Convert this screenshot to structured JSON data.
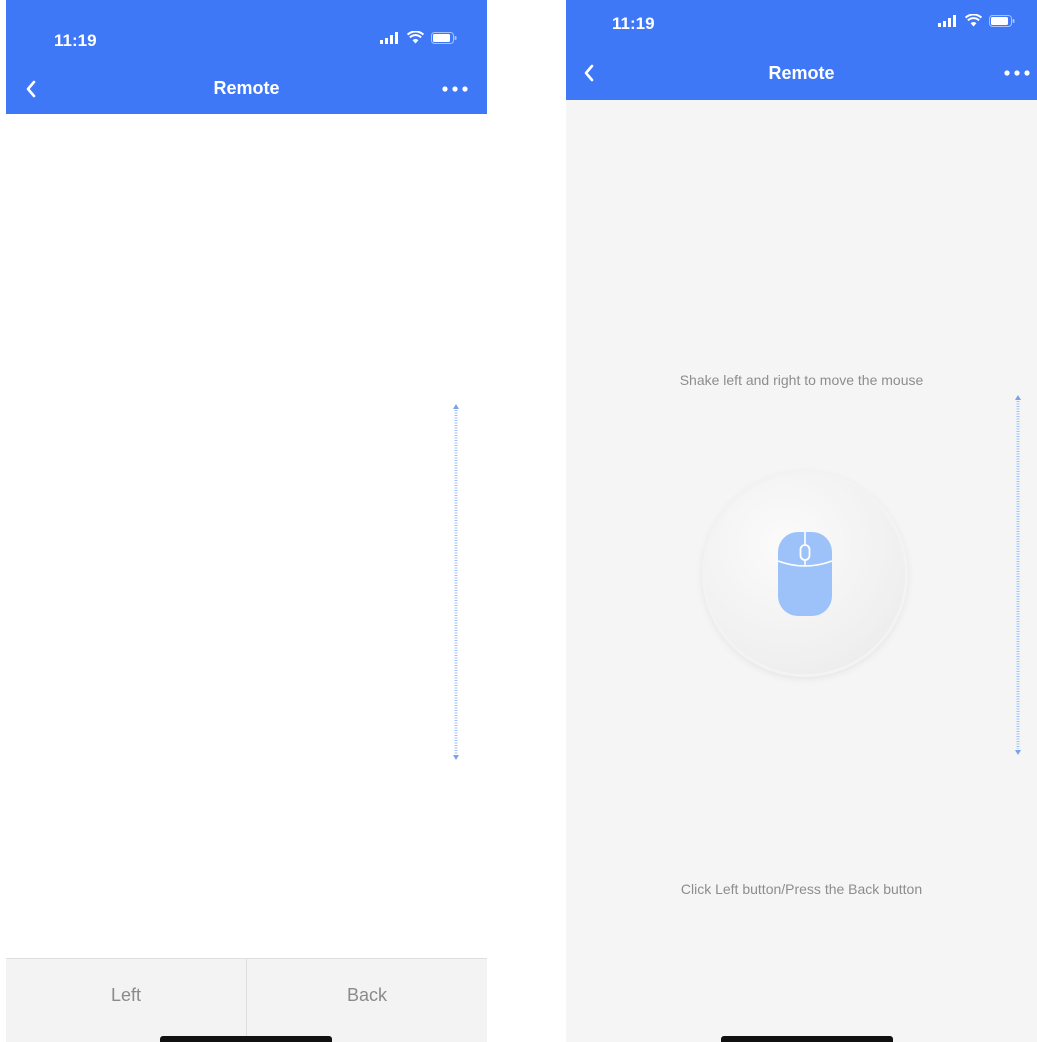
{
  "colors": {
    "header_bg": "#3f78f7",
    "header_text": "#ffffff",
    "hint_text": "#8d8d8d",
    "accent_light": "#9cc2f9",
    "page_bg_right": "#f5f5f5",
    "bottom_bar_bg": "#f3f3f3"
  },
  "screens": [
    {
      "status": {
        "time": "11:19",
        "icons": [
          "cellular-signal-icon",
          "wifi-icon",
          "battery-icon"
        ]
      },
      "header": {
        "title": "Remote",
        "back_icon": "chevron-left-icon",
        "more_icon": "more-dots-icon"
      },
      "scrollbar_icon": "vertical-scroll-track-icon",
      "bottom_bar": {
        "left_label": "Left",
        "back_label": "Back"
      }
    },
    {
      "status": {
        "time": "11:19",
        "icons": [
          "cellular-signal-icon",
          "wifi-icon",
          "battery-icon"
        ]
      },
      "header": {
        "title": "Remote",
        "back_icon": "chevron-left-icon",
        "more_icon": "more-dots-icon"
      },
      "hint_top": "Shake left and right to move the mouse",
      "hint_bottom": "Click Left button/Press the Back button",
      "mouse_icon": "mouse-icon",
      "scrollbar_icon": "vertical-scroll-track-icon"
    }
  ]
}
